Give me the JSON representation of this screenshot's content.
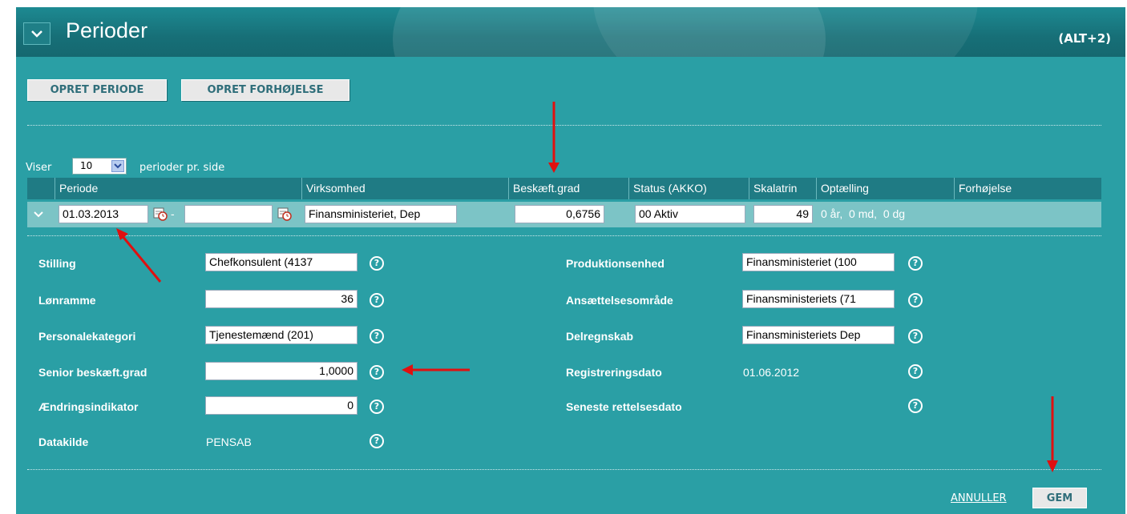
{
  "header": {
    "title": "Perioder",
    "shortcut": "(ALT+2)"
  },
  "toolbar": {
    "opret_periode": "OPRET PERIODE",
    "opret_forhoejelse": "OPRET FORHØJELSE"
  },
  "paging": {
    "prefix": "Viser",
    "page_size": "10",
    "suffix": "perioder pr. side"
  },
  "table": {
    "columns": [
      "Periode",
      "Virksomhed",
      "Beskæft.grad",
      "Status (AKKO)",
      "Skalatrin",
      "Optælling",
      "Forhøjelse"
    ],
    "row": {
      "periode_fra": "01.03.2013",
      "periode_separator": "-",
      "periode_til": "",
      "virksomhed": "Finansministeriet, Dep",
      "beskaeft_grad": "0,6756",
      "status": "00 Aktiv",
      "skalatrin": "49",
      "optaelling": "0 år,  0 md,  0 dg"
    }
  },
  "details": {
    "left": [
      {
        "label": "Stilling",
        "value": "Chefkonsulent  (4137"
      },
      {
        "label": "Lønramme",
        "value": "36"
      },
      {
        "label": "Personalekategori",
        "value": "Tjenestemænd (201)"
      },
      {
        "label": "Senior beskæft.grad",
        "value": "1,0000"
      },
      {
        "label": "Ændringsindikator",
        "value": "0"
      },
      {
        "label": "Datakilde",
        "value": "PENSAB"
      }
    ],
    "right": [
      {
        "label": "Produktionsenhed",
        "value": "Finansministeriet (100"
      },
      {
        "label": "Ansættelsesområde",
        "value": "Finansministeriets (71"
      },
      {
        "label": "Delregnskab",
        "value": "Finansministeriets Dep"
      },
      {
        "label": "Registreringsdato",
        "value": "01.06.2012"
      },
      {
        "label": "Seneste rettelsesdato",
        "value": ""
      }
    ],
    "help_glyph": "?"
  },
  "footer": {
    "annuller": "ANNULLER",
    "gem": "GEM"
  },
  "colors": {
    "panel": "#2a9fa5",
    "header": "#176f77",
    "table_header": "#1f7b84",
    "row_highlight": "#7cc4c6",
    "annotation_arrow": "#e01010"
  },
  "icons": [
    "chevron-down-icon",
    "calendar-icon",
    "help-icon"
  ]
}
